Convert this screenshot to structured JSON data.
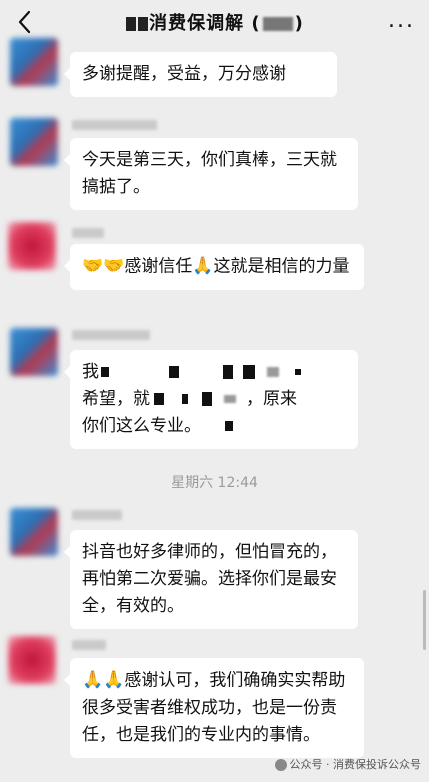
{
  "header": {
    "title_main": "消费保调解",
    "more": "...",
    "back_icon": "chevron-left-icon"
  },
  "messages": [
    {
      "text": "多谢提醒，受益，万分感谢"
    },
    {
      "text": "今天是第三天，你们真棒，三天就搞掂了。"
    },
    {
      "emoji": "🤝🤝",
      "text_a": "感谢信任",
      "emoji_b": "🙏",
      "text_b": "这就是相信的力量"
    },
    {
      "line1": "我",
      "line2_a": "希望，就",
      "line2_b": "，原来",
      "line3": "你们这么专业。"
    },
    {
      "text": "抖音也好多律师的，但怕冒充的，再怕第二次爱骗。选择你们是最安全，有效的。"
    },
    {
      "emoji": "🙏🙏",
      "text": "感谢认可，我们确确实实帮助很多受害者维权成功，也是一份责任，也是我们的专业内的事情。"
    }
  ],
  "timestamp": "星期六 12:44",
  "watermark": "公众号 · 消费保投诉公众号"
}
